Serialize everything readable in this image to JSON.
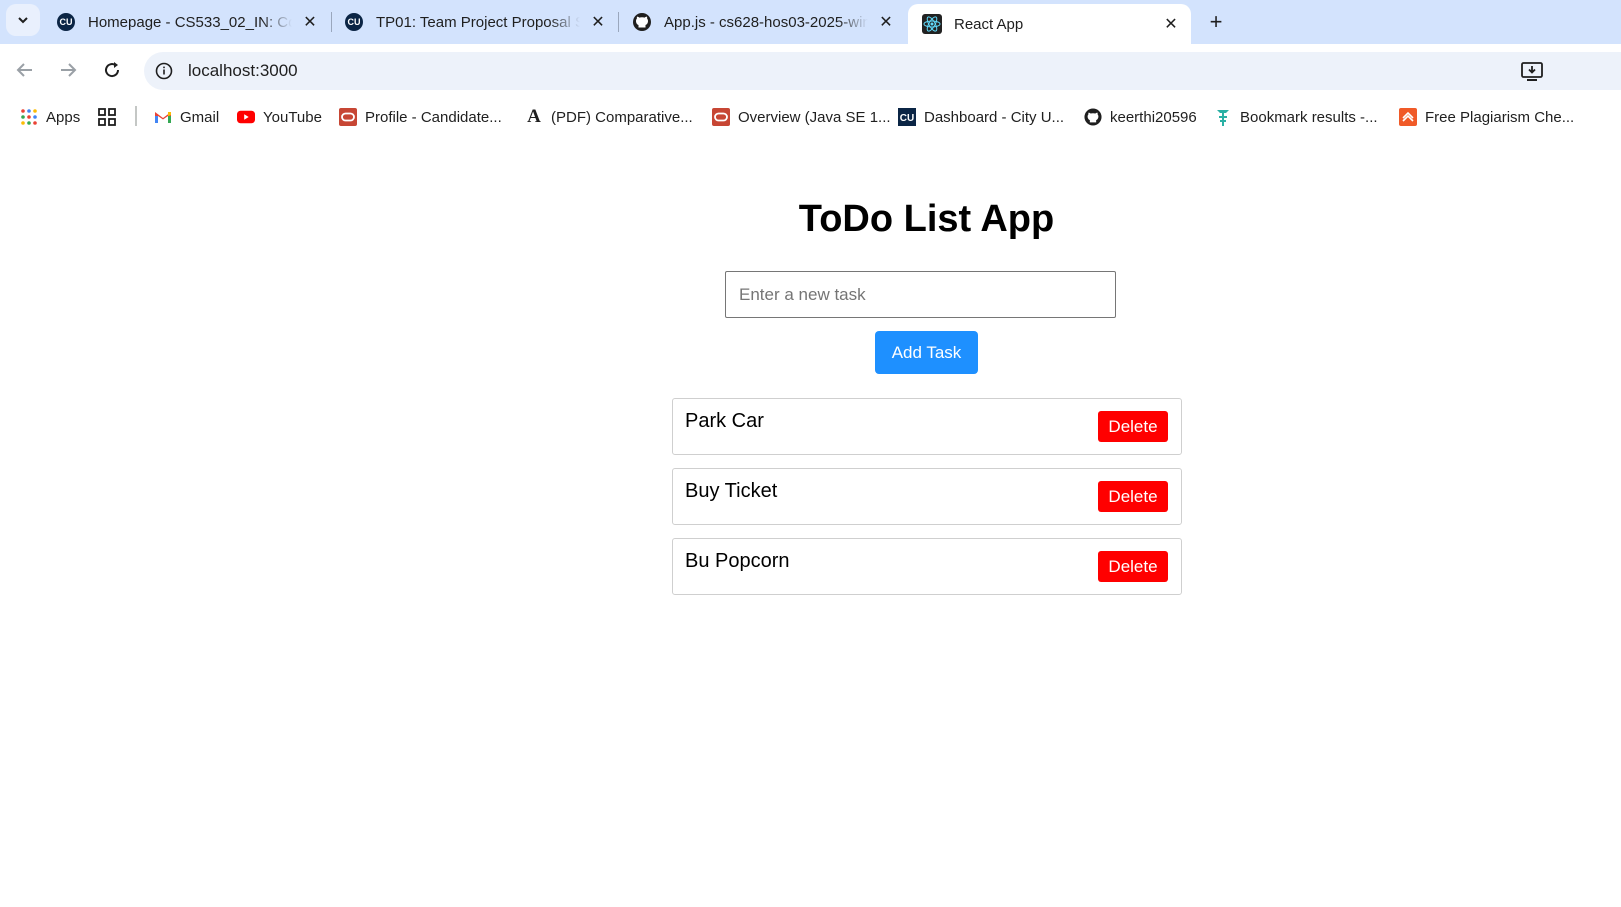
{
  "browser": {
    "tabs": [
      {
        "title": "Homepage - CS533_02_IN: Com",
        "favicon": "cu-icon"
      },
      {
        "title": "TP01: Team Project Proposal Su",
        "favicon": "cu-icon"
      },
      {
        "title": "App.js - cs628-hos03-2025-wint",
        "favicon": "github-icon"
      },
      {
        "title": "React App",
        "favicon": "react-icon",
        "active": true
      }
    ],
    "address": "localhost:3000",
    "bookmarks": [
      {
        "label": "Apps",
        "icon": "apps-grid-icon"
      },
      {
        "label": "",
        "icon": "tab-groups-icon"
      },
      {
        "label": "Gmail",
        "icon": "gmail-icon"
      },
      {
        "label": "YouTube",
        "icon": "youtube-icon"
      },
      {
        "label": "Profile - Candidate...",
        "icon": "oracle-icon"
      },
      {
        "label": "(PDF) Comparative...",
        "icon": "academia-icon"
      },
      {
        "label": "Overview (Java SE 1...",
        "icon": "oracle-icon"
      },
      {
        "label": "Dashboard - City U...",
        "icon": "cu-icon"
      },
      {
        "label": "keerthi20596",
        "icon": "github-icon"
      },
      {
        "label": "Bookmark results -...",
        "icon": "tower-icon"
      },
      {
        "label": "Free Plagiarism Che...",
        "icon": "plagiarism-icon"
      }
    ]
  },
  "app": {
    "title": "ToDo List App",
    "input_placeholder": "Enter a new task",
    "input_value": "",
    "add_label": "Add Task",
    "tasks": [
      {
        "text": "Park Car",
        "delete_label": "Delete"
      },
      {
        "text": "Buy Ticket",
        "delete_label": "Delete"
      },
      {
        "text": "Bu Popcorn",
        "delete_label": "Delete"
      }
    ]
  },
  "colors": {
    "add_button": "#1e90ff",
    "delete_button": "#ff0000",
    "tabstrip": "#d3e3fd"
  }
}
